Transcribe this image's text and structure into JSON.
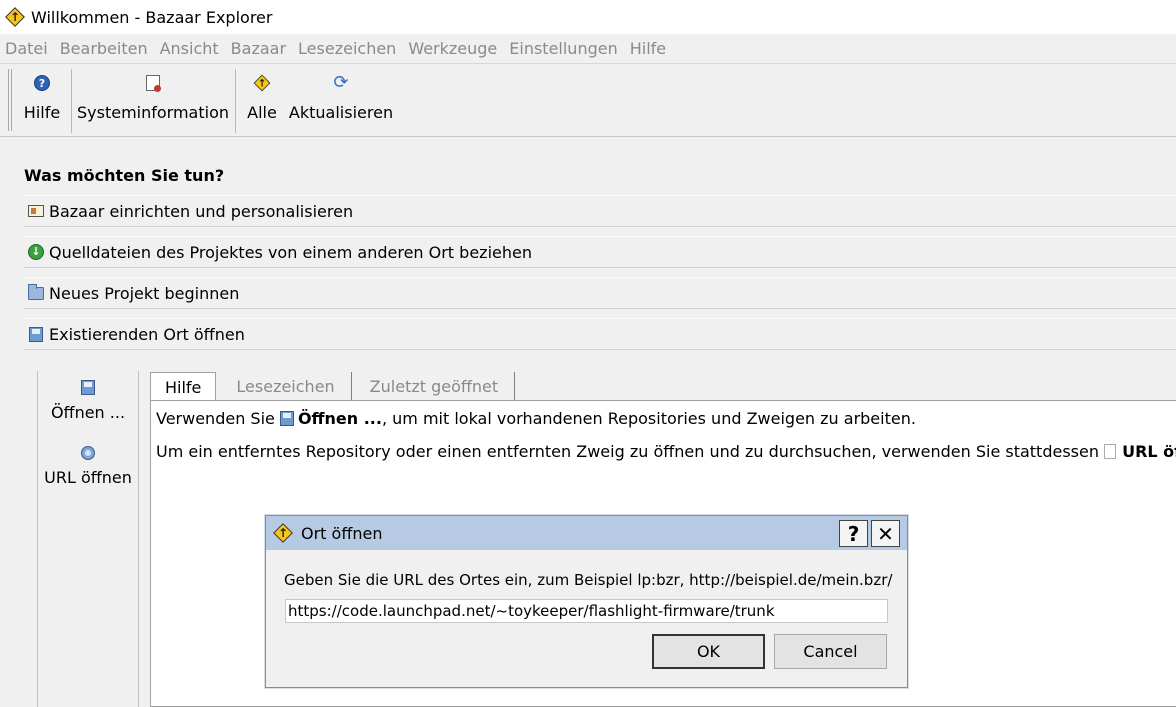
{
  "window": {
    "title": "Willkommen - Bazaar Explorer",
    "icon": "bazaar-diamond-icon"
  },
  "menubar": {
    "items": [
      "Datei",
      "Bearbeiten",
      "Ansicht",
      "Bazaar",
      "Lesezeichen",
      "Werkzeuge",
      "Einstellungen",
      "Hilfe"
    ]
  },
  "toolbar": {
    "help_label": "Hilfe",
    "sysinfo_label": "Systeminformation",
    "all_label": "Alle",
    "refresh_label": "Aktualisieren"
  },
  "main": {
    "heading": "Was möchten Sie tun?",
    "actions": [
      {
        "label": "Bazaar einrichten und personalisieren",
        "icon": "settings-card-icon"
      },
      {
        "label": "Quelldateien des Projektes von einem anderen Ort beziehen",
        "icon": "get-arrow-icon"
      },
      {
        "label": "Neues Projekt beginnen",
        "icon": "folder-icon"
      },
      {
        "label": "Existierenden Ort öffnen",
        "icon": "open-location-icon"
      }
    ]
  },
  "side": {
    "open_label": "Öffnen ...",
    "url_label": "URL öffnen"
  },
  "tabs": [
    "Hilfe",
    "Lesezeichen",
    "Zuletzt geöffnet"
  ],
  "help": {
    "line1_pre": "Verwenden Sie ",
    "line1_bold": "Öffnen ...",
    "line1_post": ", um mit lokal vorhandenen Repositories und Zweigen zu arbeiten.",
    "line2_pre": "Um ein entferntes Repository oder einen entfernten Zweig zu öffnen und zu durchsuchen, verwenden Sie stattdessen ",
    "line2_bold": "URL öffnen",
    "line2_post": "."
  },
  "dialog": {
    "title": "Ort öffnen",
    "help_btn": "?",
    "close_btn": "✕",
    "prompt": "Geben Sie die URL des Ortes ein, zum Beispiel lp:bzr, http://beispiel.de/mein.bzr/",
    "url_value": "https://code.launchpad.net/~toykeeper/flashlight-firmware/trunk",
    "ok_label": "OK",
    "cancel_label": "Cancel"
  }
}
